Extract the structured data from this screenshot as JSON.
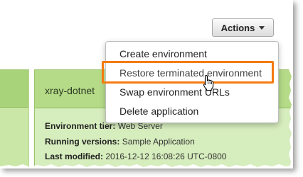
{
  "toolbar": {
    "actions_label": "Actions"
  },
  "environment": {
    "name": "xray-dotnet",
    "tier_label": "Environment tier:",
    "tier_value": "Web Server",
    "versions_label": "Running versions:",
    "versions_value": "Sample Application",
    "modified_label": "Last modified:",
    "modified_value": "2016-12-12 16:08:26 UTC-0800"
  },
  "actions_menu": {
    "items": [
      {
        "label": "Create environment"
      },
      {
        "label": "Restore terminated environment"
      },
      {
        "label": "Swap environment URLs"
      },
      {
        "label": "Delete application"
      }
    ],
    "highlighted_index": 1
  },
  "colors": {
    "highlight": "#f47b10",
    "card_header": "#b5db88",
    "card_body": "#d6edbd"
  },
  "icons": {
    "cursor": "hand-pointer-icon",
    "caret": "caret-down-icon"
  }
}
